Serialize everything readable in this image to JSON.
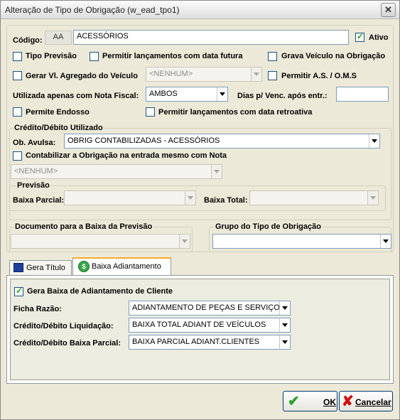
{
  "window": {
    "title": "Alteração de Tipo de Obrigação (w_ead_tpo1)",
    "close_glyph": "✕"
  },
  "codigo": {
    "label": "Código:",
    "prefix": "AA",
    "value": "ACESSÓRIOS"
  },
  "ativo": {
    "label": "Ativo",
    "checked": true
  },
  "tipo_previsao": {
    "label": "Tipo Previsão",
    "checked": false
  },
  "permitir_futura": {
    "label": "Permitir lançamentos com data futura",
    "checked": false
  },
  "grava_veiculo": {
    "label": "Grava Veículo na Obrigação",
    "checked": false
  },
  "gerar_vl": {
    "label": "Gerar Vl. Agregado do Veículo",
    "checked": false,
    "combo_value": "<NENHUM>"
  },
  "permitir_as": {
    "label": "Permitir A.S. / O.M.S",
    "checked": false
  },
  "nota_fiscal": {
    "label": "Utilizada apenas com Nota Fiscal:",
    "value": "AMBOS"
  },
  "dias_venc": {
    "label": "Dias p/ Venc. após entr.:",
    "value": ""
  },
  "permite_endosso": {
    "label": "Permite Endosso",
    "checked": false
  },
  "permitir_retroativa": {
    "label": "Permitir lançamentos com data retroativa",
    "checked": false
  },
  "credito_debito": {
    "group_label": "Crédito/Débito Utilizado",
    "ob_label": "Ob. Avulsa:",
    "ob_value": "OBRIG CONTABILIZADAS - ACESSÓRIOS"
  },
  "contabilizar": {
    "label": "Contabilizar a Obrigação na entrada mesmo com Nota",
    "checked": false,
    "combo_value": "<NENHUM>"
  },
  "previsao": {
    "group_label": "Previsão",
    "baixa_parcial": "Baixa Parcial:",
    "baixa_total": "Baixa Total:"
  },
  "documento": {
    "label": "Documento para a Baixa da Previsão"
  },
  "grupo": {
    "label": "Grupo do Tipo de Obrigação"
  },
  "tabs": [
    {
      "label": "Gera Título"
    },
    {
      "label": "Baixa Adiantamento"
    }
  ],
  "adiantamento": {
    "gera_baixa": {
      "label": "Gera Baixa de Adiantamento de Cliente",
      "checked": true
    },
    "ficha_razao": {
      "label": "Ficha Razão:",
      "value": "ADIANTAMENTO DE PEÇAS E SERVIÇOS"
    },
    "liquidacao": {
      "label": "Crédito/Débito Liquidação:",
      "value": "BAIXA TOTAL ADIANT DE VEÍCULOS"
    },
    "baixa_parcial": {
      "label": "Crédito/Débito Baixa Parcial:",
      "value": "BAIXA PARCIAL ADIANT.CLIENTES"
    }
  },
  "buttons": {
    "ok": "OK",
    "cancel": "Cancelar"
  },
  "colors": {
    "ok_check": "#2aa32a",
    "cancel_x": "#cc1111",
    "tab_accent": "#f7a92d"
  }
}
